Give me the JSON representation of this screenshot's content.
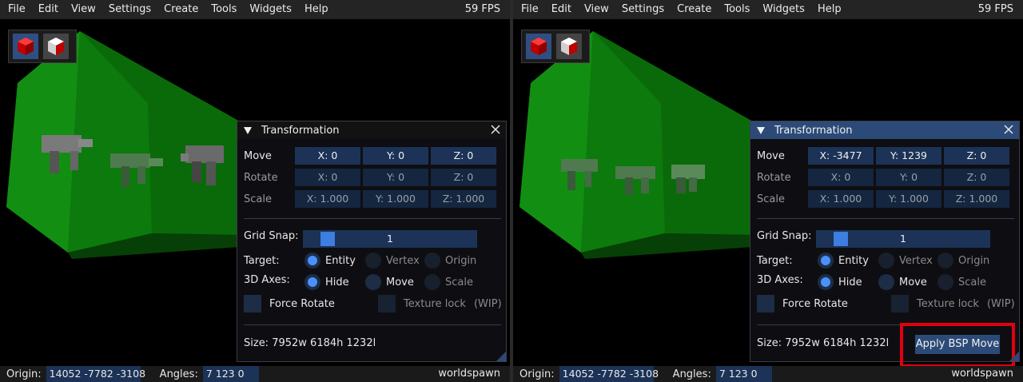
{
  "menu": [
    "File",
    "Edit",
    "View",
    "Settings",
    "Create",
    "Tools",
    "Widgets",
    "Help"
  ],
  "fps": "59 FPS",
  "colors": {
    "menu_bg": "#242424",
    "accent": "#2c4a78",
    "field_bg": "#1c3357",
    "radio_on": "#4a90ff",
    "highlight": "#e00010",
    "brush_green": "#0f8a0f"
  },
  "toolbox": {
    "buttons": [
      {
        "icon": "red-cube-icon",
        "active": true
      },
      {
        "icon": "red-white-cube-icon",
        "active": false
      }
    ]
  },
  "left": {
    "window": {
      "title": "Transformation",
      "move": {
        "label": "Move",
        "x": "X: 0",
        "y": "Y: 0",
        "z": "Z: 0"
      },
      "rotate": {
        "label": "Rotate",
        "x": "X: 0",
        "y": "Y: 0",
        "z": "Z: 0"
      },
      "scale": {
        "label": "Scale",
        "x": "X: 1.000",
        "y": "Y: 1.000",
        "z": "Z: 1.000"
      },
      "grid_snap": {
        "label": "Grid Snap:",
        "value": "1"
      },
      "target": {
        "label": "Target:",
        "options": [
          "Entity",
          "Vertex",
          "Origin"
        ],
        "selected": "Entity"
      },
      "axes": {
        "label": "3D Axes:",
        "options": [
          "Hide",
          "Move",
          "Scale"
        ],
        "selected": "Hide"
      },
      "force_rotate": "Force Rotate",
      "texture_lock": "Texture lock",
      "texture_lock_suffix": "(WIP)",
      "size": "Size: 7952w 6184h 1232l"
    },
    "status": {
      "origin_label": "Origin:",
      "origin": "14052 -7782 -3108",
      "angles_label": "Angles:",
      "angles": "7 123 0",
      "entity": "worldspawn"
    }
  },
  "right": {
    "window": {
      "title": "Transformation",
      "move": {
        "label": "Move",
        "x": "X: -3477",
        "y": "Y: 1239",
        "z": "Z: 0"
      },
      "rotate": {
        "label": "Rotate",
        "x": "X: 0",
        "y": "Y: 0",
        "z": "Z: 0"
      },
      "scale": {
        "label": "Scale",
        "x": "X: 1.000",
        "y": "Y: 1.000",
        "z": "Z: 1.000"
      },
      "grid_snap": {
        "label": "Grid Snap:",
        "value": "1"
      },
      "target": {
        "label": "Target:",
        "options": [
          "Entity",
          "Vertex",
          "Origin"
        ],
        "selected": "Entity"
      },
      "axes": {
        "label": "3D Axes:",
        "options": [
          "Hide",
          "Move",
          "Scale"
        ],
        "selected": "Hide"
      },
      "force_rotate": "Force Rotate",
      "texture_lock": "Texture lock",
      "texture_lock_suffix": "(WIP)",
      "size": "Size: 7952w 6184h 1232l",
      "apply_button": "Apply BSP Move"
    },
    "status": {
      "origin_label": "Origin:",
      "origin": "14052 -7782 -3108",
      "angles_label": "Angles:",
      "angles": "7 123 0",
      "entity": "worldspawn"
    }
  }
}
